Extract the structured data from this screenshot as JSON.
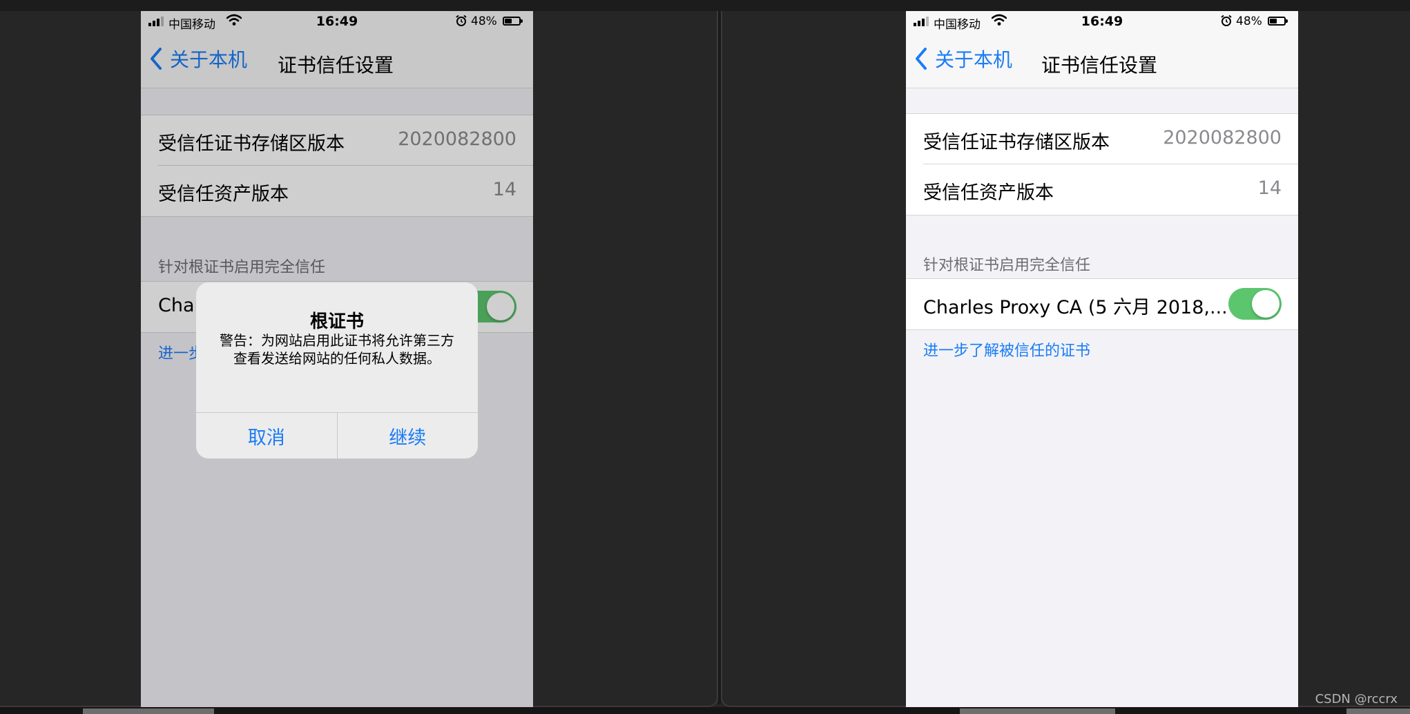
{
  "status": {
    "carrier": "中国移动",
    "time": "16:49",
    "battery": "48%"
  },
  "nav": {
    "back_label": "关于本机",
    "title": "证书信任设置"
  },
  "store_rows": [
    {
      "label": "受信任证书存储区版本",
      "value": "2020082800"
    },
    {
      "label": "受信任资产版本",
      "value": "14"
    }
  ],
  "section_header": "针对根证书启用完全信任",
  "left_cert_label": "Char",
  "left_footer_link": "进一步",
  "cert_row": {
    "label": "Charles Proxy CA (5 六月 2018,...",
    "enabled": true
  },
  "footer_link": "进一步了解被信任的证书",
  "alert": {
    "title": "根证书",
    "message": "警告：为网站启用此证书将允许第三方查看发送给网站的任何私人数据。",
    "cancel": "取消",
    "continue": "继续"
  },
  "watermark": "CSDN @rccrx",
  "colors": {
    "accent": "#1a7cf5",
    "toggle_on": "#5cc66e",
    "desktop": "#262626"
  }
}
